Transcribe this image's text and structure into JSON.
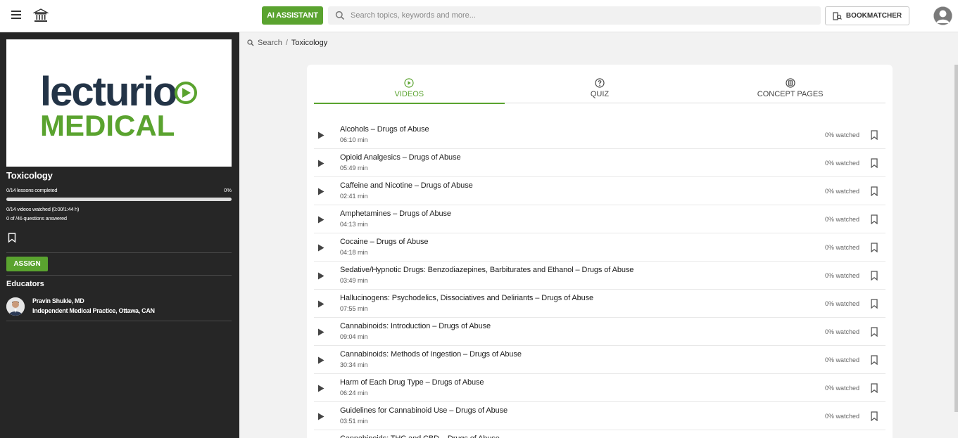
{
  "header": {
    "ai_assistant_label": "AI ASSISTANT",
    "search_placeholder": "Search topics, keywords and more...",
    "bookmatcher_label": "BOOKMATCHER"
  },
  "sidebar": {
    "logo_text_top": "lecturio",
    "logo_text_bottom": "MEDICAL",
    "course_title": "Toxicology",
    "lessons_completed": "0/14 lessons completed",
    "progress_percent_label": "0%",
    "progress_fraction": 0,
    "videos_watched": "0/14 videos watched (0:00/1:44 h)",
    "questions_answered": "0 of /46 questions answered",
    "assign_label": "ASSIGN",
    "educators_title": "Educators",
    "educator": {
      "name": "Pravin Shukle, MD",
      "affiliation": "Independent Medical Practice, Ottawa, CAN"
    }
  },
  "breadcrumb": {
    "search": "Search",
    "separator": "/",
    "current": "Toxicology"
  },
  "tabs": [
    {
      "label": "VIDEOS",
      "icon": "play-circle-icon",
      "active": true
    },
    {
      "label": "QUIZ",
      "icon": "question-circle-icon",
      "active": false
    },
    {
      "label": "CONCEPT PAGES",
      "icon": "concept-page-icon",
      "active": false
    }
  ],
  "videos": [
    {
      "title": "Alcohols – Drugs of Abuse",
      "duration": "06:10 min",
      "watched": "0% watched"
    },
    {
      "title": "Opioid Analgesics – Drugs of Abuse",
      "duration": "05:49 min",
      "watched": "0% watched"
    },
    {
      "title": "Caffeine and Nicotine – Drugs of Abuse",
      "duration": "02:41 min",
      "watched": "0% watched"
    },
    {
      "title": "Amphetamines – Drugs of Abuse",
      "duration": "04:13 min",
      "watched": "0% watched"
    },
    {
      "title": "Cocaine – Drugs of Abuse",
      "duration": "04:18 min",
      "watched": "0% watched"
    },
    {
      "title": "Sedative/Hypnotic Drugs: Benzodiazepines, Barbiturates and Ethanol – Drugs of Abuse",
      "duration": "03:49 min",
      "watched": "0% watched"
    },
    {
      "title": "Hallucinogens: Psychodelics, Dissociatives and Deliriants – Drugs of Abuse",
      "duration": "07:55 min",
      "watched": "0% watched"
    },
    {
      "title": "Cannabinoids: Introduction – Drugs of Abuse",
      "duration": "09:04 min",
      "watched": "0% watched"
    },
    {
      "title": "Cannabinoids: Methods of Ingestion – Drugs of Abuse",
      "duration": "30:34 min",
      "watched": "0% watched"
    },
    {
      "title": "Harm of Each Drug Type – Drugs of Abuse",
      "duration": "06:24 min",
      "watched": "0% watched"
    },
    {
      "title": "Guidelines for Cannabinoid Use – Drugs of Abuse",
      "duration": "03:51 min",
      "watched": "0% watched"
    },
    {
      "title": "Cannabinoids: THC and CBD – Drugs of Abuse",
      "duration": "",
      "watched": ""
    }
  ],
  "colors": {
    "accent": "#5aa32f",
    "sidebar_bg": "#262626",
    "logo_navy": "#233447"
  }
}
